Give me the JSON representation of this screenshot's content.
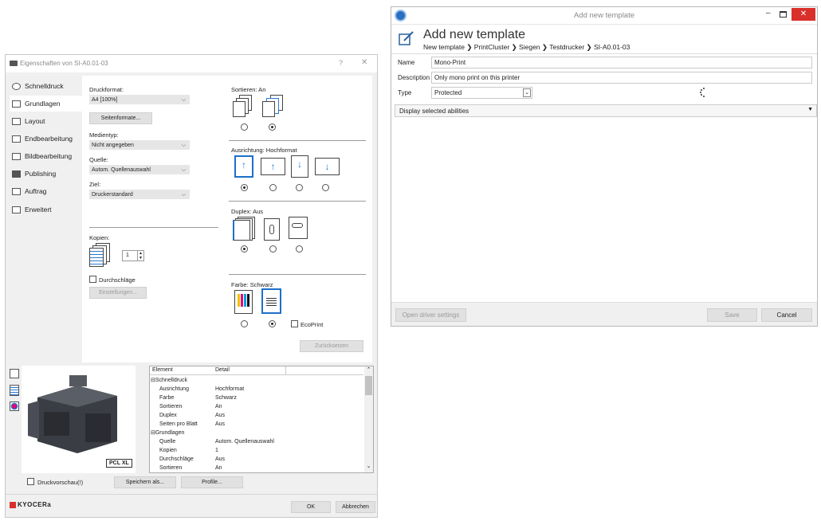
{
  "left_dialog": {
    "title": "Eigenschaften von SI-A0.01-03",
    "help": "?",
    "close": "✕",
    "sidebar": [
      {
        "label": "Schnelldruck",
        "icon": "quickprint-icon"
      },
      {
        "label": "Grundlagen",
        "icon": "basics-icon"
      },
      {
        "label": "Layout",
        "icon": "layout-icon"
      },
      {
        "label": "Endbearbeitung",
        "icon": "finishing-icon"
      },
      {
        "label": "Bildbearbeitung",
        "icon": "image-icon"
      },
      {
        "label": "Publishing",
        "icon": "publishing-icon"
      },
      {
        "label": "Auftrag",
        "icon": "job-icon"
      },
      {
        "label": "Erweitert",
        "icon": "advanced-icon"
      }
    ],
    "druckformat_label": "Druckformat:",
    "druckformat_value": "A4 [100%]",
    "seitenformate_btn": "Seitenformate...",
    "medientyp_label": "Medientyp:",
    "medientyp_value": "Nicht angegeben",
    "quelle_label": "Quelle:",
    "quelle_value": "Autom. Quellenauswahl",
    "ziel_label": "Ziel:",
    "ziel_value": "Druckerstandard",
    "kopien_label": "Kopien:",
    "kopien_value": "1",
    "durchschlaege_label": "Durchschläge",
    "einstellungen_btn": "Einstellungen...",
    "sortieren_label": "Sortieren: An",
    "ausrichtung_label": "Ausrichtung: Hochformat",
    "duplex_label": "Duplex: Aus",
    "farbe_label": "Farbe: Schwarz",
    "ecoprint_label": "EcoPrint",
    "zuruecksetzen_btn": "Zurücksetzen",
    "pcl_badge": "PCL XL",
    "detail_headers": [
      "Element",
      "Detail"
    ],
    "detail_rows": [
      {
        "element": "⊟Schnelldruck",
        "detail": "",
        "indent": false
      },
      {
        "element": "Ausrichtung",
        "detail": "Hochformat",
        "indent": true
      },
      {
        "element": "Farbe",
        "detail": "Schwarz",
        "indent": true
      },
      {
        "element": "Sortieren",
        "detail": "An",
        "indent": true
      },
      {
        "element": "Duplex",
        "detail": "Aus",
        "indent": true
      },
      {
        "element": "Seiten pro Blatt",
        "detail": "Aus",
        "indent": true
      },
      {
        "element": "⊟Grundlagen",
        "detail": "",
        "indent": false
      },
      {
        "element": "Quelle",
        "detail": "Autom. Quellenauswahl",
        "indent": true
      },
      {
        "element": "Kopien",
        "detail": "1",
        "indent": true
      },
      {
        "element": "Durchschläge",
        "detail": "Aus",
        "indent": true
      },
      {
        "element": "Sortieren",
        "detail": "An",
        "indent": true
      }
    ],
    "druckvorschau_label": "Druckvorschau(!)",
    "speichern_btn": "Speichern als...",
    "profile_btn": "Profile...",
    "brand": "KYOCERa",
    "ok_btn": "OK",
    "abbrechen_btn": "Abbrechen"
  },
  "right_dialog": {
    "window_title": "Add new template",
    "heading": "Add new template",
    "breadcrumb": "New template ❯ PrintCluster ❯ Siegen ❯ Testdrucker ❯ SI-A0.01-03",
    "name_label": "Name",
    "name_value": "Mono-Print",
    "description_label": "Description",
    "description_value": "Only mono print on this printer",
    "type_label": "Type",
    "type_value": "Protected",
    "abilities_label": "Display selected abilities",
    "open_driver_btn": "Open driver settings",
    "save_btn": "Save",
    "cancel_btn": "Cancel"
  },
  "colors": {
    "accent": "#1e6fc8",
    "close_red": "#d9302c"
  }
}
